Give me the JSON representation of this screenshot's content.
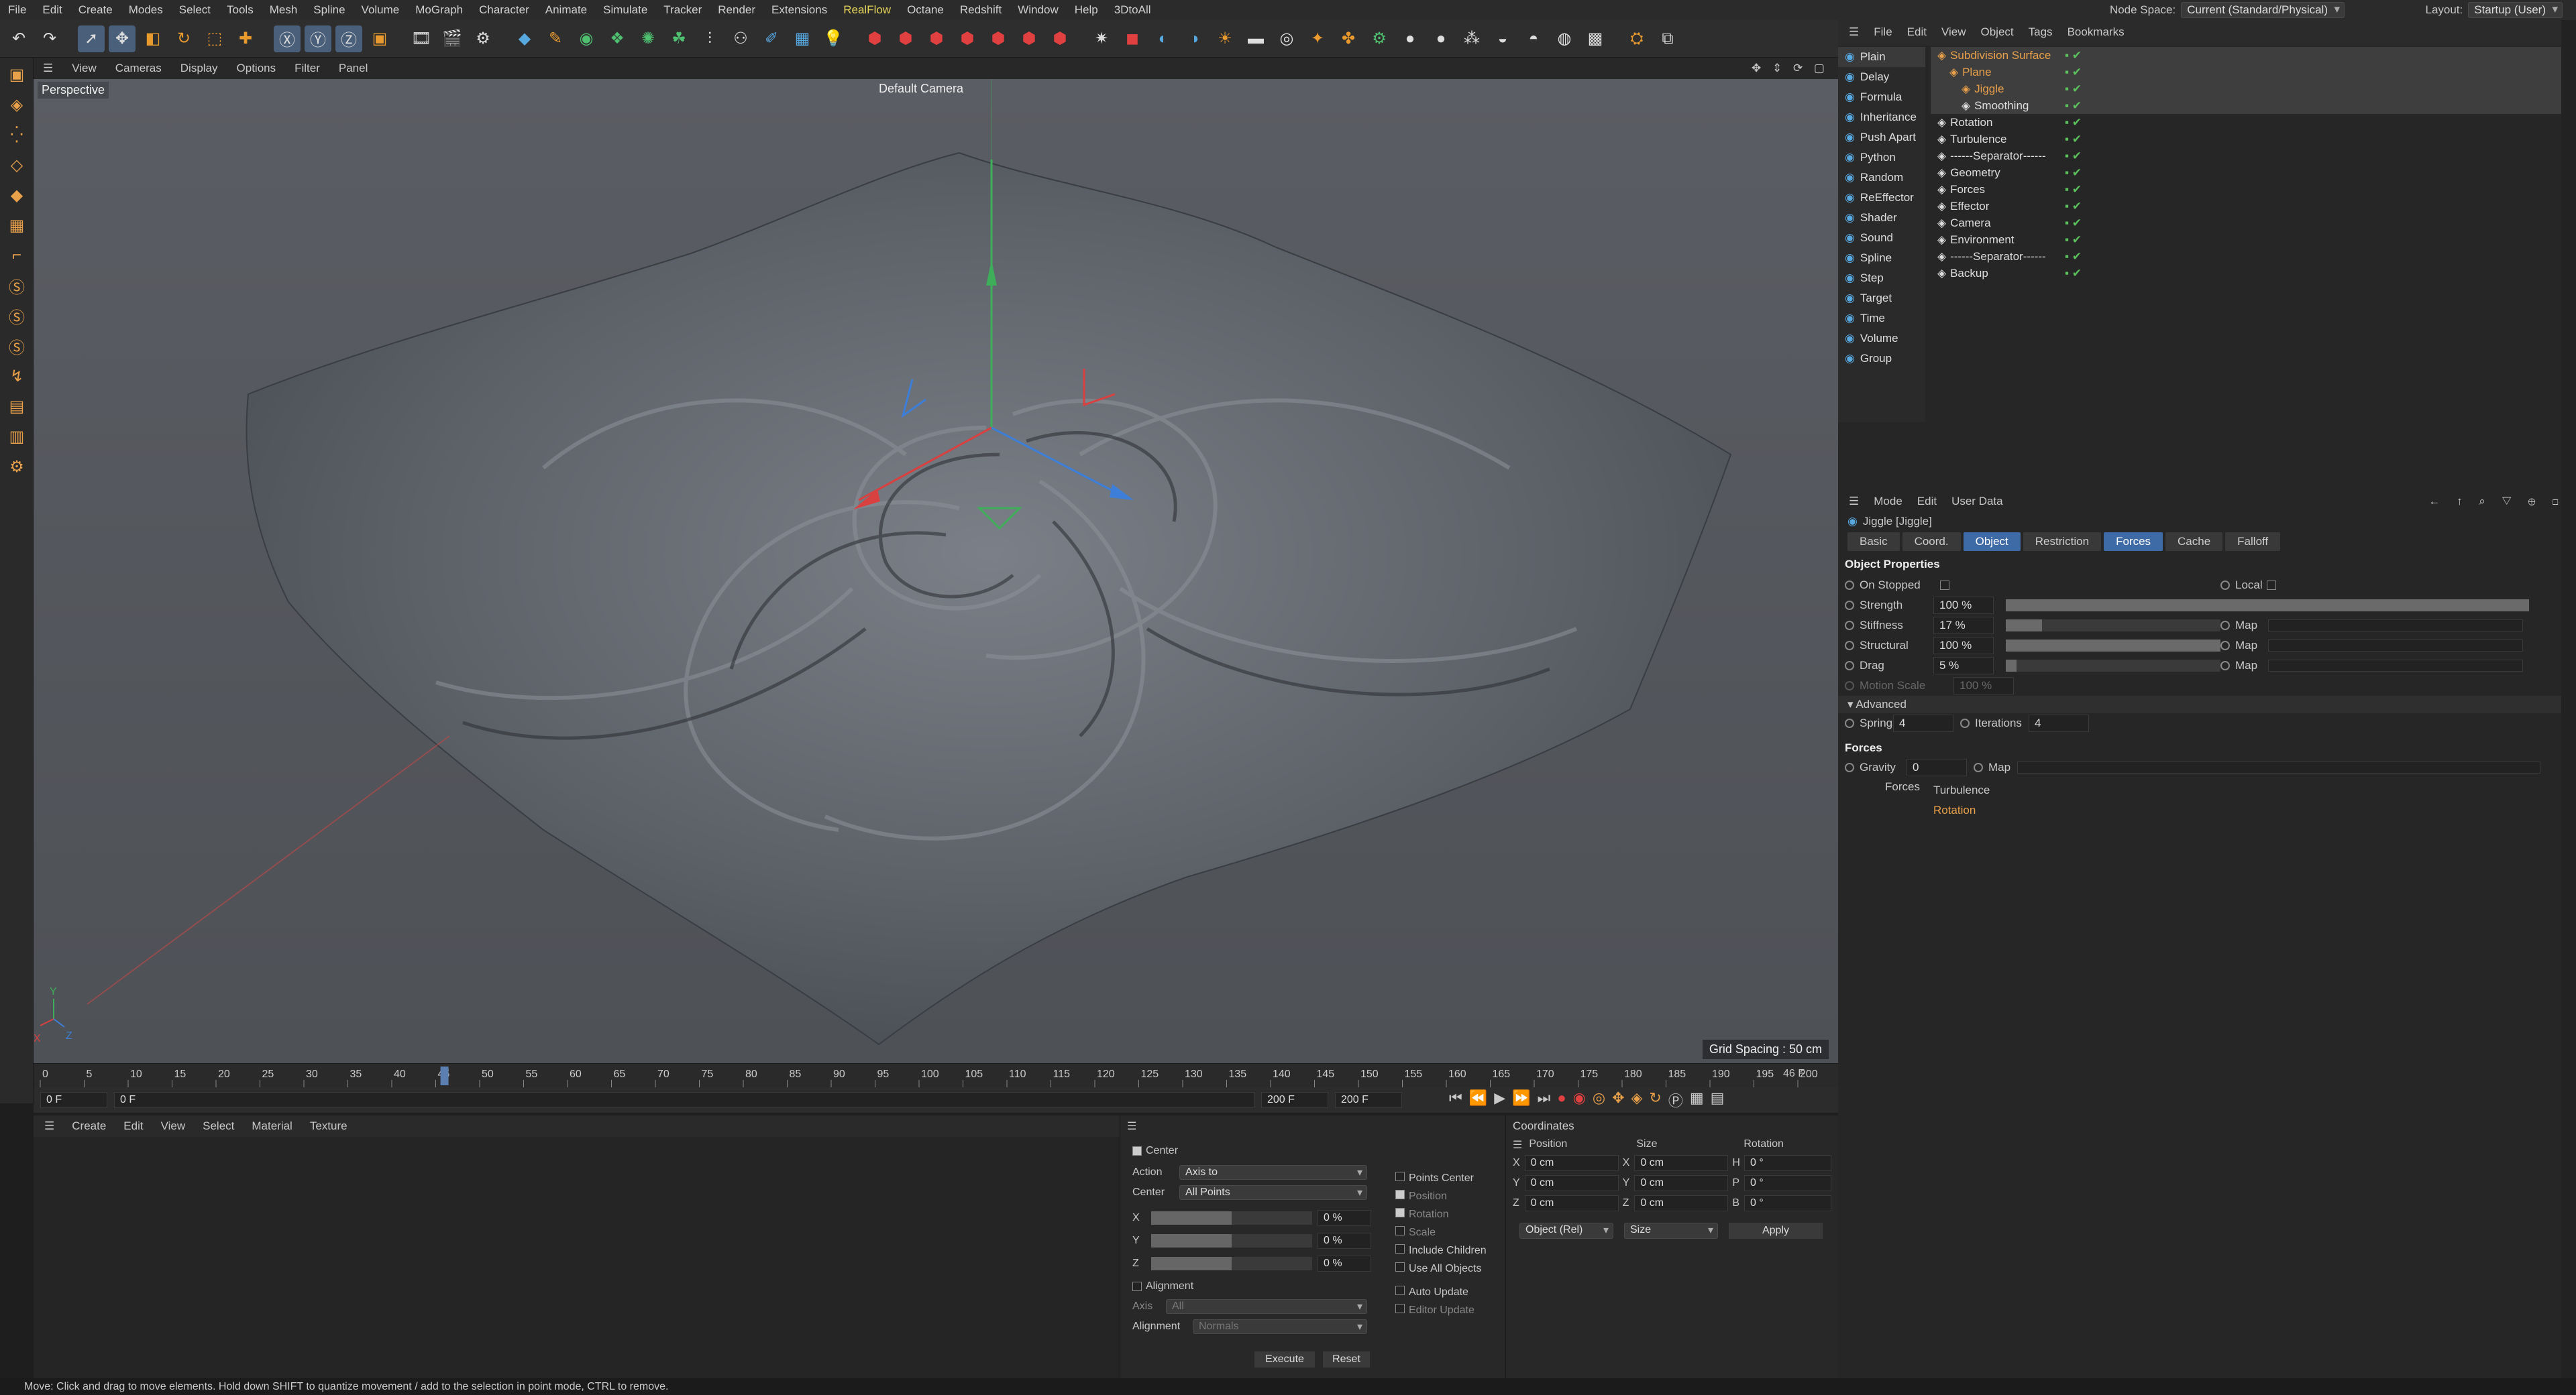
{
  "menubar": {
    "items": [
      "File",
      "Edit",
      "Create",
      "Modes",
      "Select",
      "Tools",
      "Mesh",
      "Spline",
      "Volume",
      "MoGraph",
      "Character",
      "Animate",
      "Simulate",
      "Tracker",
      "Render",
      "Extensions",
      "RealFlow",
      "Octane",
      "Redshift",
      "Window",
      "Help",
      "3DtoAll"
    ],
    "active_item": "RealFlow",
    "node_space_label": "Node Space:",
    "node_space_value": "Current (Standard/Physical)",
    "layout_label": "Layout:",
    "layout_value": "Startup (User)"
  },
  "viewport_menu": {
    "items": [
      "View",
      "Cameras",
      "Display",
      "Options",
      "Filter",
      "Panel"
    ]
  },
  "viewport": {
    "projection_label": "Perspective",
    "camera_label": "Default Camera",
    "grid_spacing": "Grid Spacing : 50 cm"
  },
  "timeline": {
    "ticks": [
      "0",
      "5",
      "10",
      "15",
      "20",
      "25",
      "30",
      "35",
      "40",
      "45",
      "50",
      "55",
      "60",
      "65",
      "70",
      "75",
      "80",
      "85",
      "90",
      "95",
      "100",
      "105",
      "110",
      "115",
      "120",
      "125",
      "130",
      "135",
      "140",
      "145",
      "150",
      "155",
      "160",
      "165",
      "170",
      "175",
      "180",
      "185",
      "190",
      "195",
      "200"
    ],
    "current_frame_marker": "46",
    "end_frame_label": "46 F",
    "current_frame": "0 F",
    "start_frame": "0 F",
    "end_frame": "200 F",
    "end_frame_2": "200 F"
  },
  "material_manager": {
    "menu": [
      "Create",
      "Edit",
      "View",
      "Select",
      "Material",
      "Texture"
    ]
  },
  "center_panel": {
    "center_label": "Center",
    "center_checked": true,
    "action_label": "Action",
    "action_value": "Axis to",
    "center_field_label": "Center",
    "center_field_value": "All Points",
    "x_label": "X",
    "x_value": "0 %",
    "y_label": "Y",
    "y_value": "0 %",
    "z_label": "Z",
    "z_value": "0 %",
    "points_center": "Points Center",
    "position": "Position",
    "rotation": "Rotation",
    "scale": "Scale",
    "include_children": "Include Children",
    "use_all_objects": "Use All Objects",
    "alignment_label": "Alignment",
    "axis_label": "Axis",
    "axis_value": "All",
    "alignment_field_label": "Alignment",
    "alignment_field_value": "Normals",
    "auto_update": "Auto Update",
    "editor_update": "Editor Update",
    "execute_button": "Execute",
    "reset_button": "Reset"
  },
  "coordinates": {
    "title": "Coordinates",
    "position_header": "Position",
    "size_header": "Size",
    "rotation_header": "Rotation",
    "rows": [
      {
        "axis": "X",
        "pos": "0 cm",
        "size_axis": "X",
        "size": "0 cm",
        "rot_axis": "H",
        "rot": "0 °"
      },
      {
        "axis": "Y",
        "pos": "0 cm",
        "size_axis": "Y",
        "size": "0 cm",
        "rot_axis": "P",
        "rot": "0 °"
      },
      {
        "axis": "Z",
        "pos": "0 cm",
        "size_axis": "Z",
        "size": "0 cm",
        "rot_axis": "B",
        "rot": "0 °"
      }
    ],
    "mode_value": "Object (Rel)",
    "size_mode_value": "Size",
    "apply_button": "Apply"
  },
  "object_manager": {
    "menu": [
      "File",
      "Edit",
      "View",
      "Object",
      "Tags",
      "Bookmarks"
    ],
    "quick_list": [
      "Plain",
      "Delay",
      "Formula",
      "Inheritance",
      "Push Apart",
      "Python",
      "Random",
      "ReEffector",
      "Shader",
      "Sound",
      "Spline",
      "Step",
      "Target",
      "Time",
      "Volume",
      "Group"
    ],
    "tree": [
      {
        "name": "Subdivision Surface",
        "indent": 0,
        "color": "#e8a04a"
      },
      {
        "name": "Plane",
        "indent": 1,
        "color": "#e8a04a"
      },
      {
        "name": "Jiggle",
        "indent": 2,
        "color": "#e8a04a"
      },
      {
        "name": "Smoothing",
        "indent": 2,
        "color": "#dddddd"
      },
      {
        "name": "Rotation",
        "indent": 0,
        "color": "#dddddd"
      },
      {
        "name": "Turbulence",
        "indent": 0,
        "color": "#dddddd"
      },
      {
        "name": "------Separator------",
        "indent": 0,
        "color": "#dddddd"
      },
      {
        "name": "Geometry",
        "indent": 0,
        "color": "#dddddd"
      },
      {
        "name": "Forces",
        "indent": 0,
        "color": "#dddddd"
      },
      {
        "name": "Effector",
        "indent": 0,
        "color": "#dddddd"
      },
      {
        "name": "Camera",
        "indent": 0,
        "color": "#dddddd"
      },
      {
        "name": "Environment",
        "indent": 0,
        "color": "#dddddd"
      },
      {
        "name": "------Separator------",
        "indent": 0,
        "color": "#dddddd"
      },
      {
        "name": "Backup",
        "indent": 0,
        "color": "#dddddd"
      }
    ]
  },
  "attributes": {
    "menu": [
      "Mode",
      "Edit",
      "User Data"
    ],
    "object_title": "Jiggle [Jiggle]",
    "tabs": [
      "Basic",
      "Coord.",
      "Object",
      "Restriction",
      "Forces",
      "Cache",
      "Falloff"
    ],
    "active_tabs": [
      "Object",
      "Forces"
    ],
    "section_object": "Object Properties",
    "on_stopped": "On Stopped",
    "local": "Local",
    "props": [
      {
        "label": "Strength",
        "value": "100 %",
        "fraction": 1.0,
        "has_map": false
      },
      {
        "label": "Stiffness",
        "value": "17 %",
        "fraction": 0.17,
        "has_map": true
      },
      {
        "label": "Structural",
        "value": "100 %",
        "fraction": 1.0,
        "has_map": true
      },
      {
        "label": "Drag",
        "value": "5 %",
        "fraction": 0.05,
        "has_map": true
      }
    ],
    "map_label": "Map",
    "motion_scale_label": "Motion Scale",
    "motion_scale_value": "100 %",
    "advanced_label": "Advanced",
    "springs_label": "Springs",
    "springs_value": "4",
    "iterations_label": "Iterations",
    "iterations_value": "4",
    "section_forces": "Forces",
    "gravity_label": "Gravity",
    "gravity_value": "0",
    "forces_label": "Forces",
    "forces_list": [
      "Turbulence",
      "Rotation"
    ]
  },
  "statusbar": {
    "text": "Move: Click and drag to move elements. Hold down SHIFT to quantize movement / add to the selection in point mode, CTRL to remove."
  },
  "colors": {
    "accent_orange": "#e8a04a",
    "tab_active": "#3e6aa6",
    "realflow_yellow": "#e3d35a"
  }
}
